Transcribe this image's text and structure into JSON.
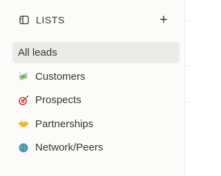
{
  "sidebar": {
    "header": {
      "title": "LISTS",
      "icon": "sidebar-list-icon",
      "add_label": "+"
    },
    "items": [
      {
        "label": "All leads",
        "icon": null,
        "selected": true
      },
      {
        "label": "Customers",
        "icon": "money-with-wings-icon",
        "selected": false
      },
      {
        "label": "Prospects",
        "icon": "target-icon",
        "selected": false
      },
      {
        "label": "Partnerships",
        "icon": "handshake-icon",
        "selected": false
      },
      {
        "label": "Network/Peers",
        "icon": "globe-icon",
        "selected": false
      }
    ]
  },
  "colors": {
    "sidebar_bg": "#fbfbfa",
    "active_bg": "#ebebea",
    "text": "#37352f"
  }
}
